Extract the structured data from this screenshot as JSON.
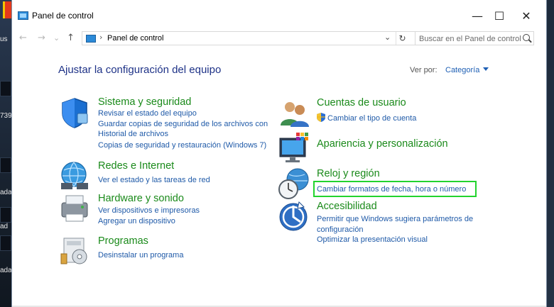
{
  "window": {
    "title": "Panel de control",
    "minimize_glyph": "—",
    "maximize_glyph": "☐",
    "close_glyph": "✕"
  },
  "desktop": {
    "labels": [
      "us",
      "739",
      "ada",
      "ad",
      "ada"
    ]
  },
  "nav": {
    "back_glyph": "←",
    "forward_glyph": "→",
    "dropdown_glyph": "⌄",
    "up_glyph": "↑",
    "breadcrumb_sep": "›",
    "breadcrumb": "Panel de control",
    "addr_dropdown_glyph": "⌄",
    "refresh_glyph": "↻",
    "search_placeholder": "Buscar en el Panel de control"
  },
  "header": {
    "title": "Ajustar la configuración del equipo",
    "view_by_label": "Ver por:",
    "view_by_value": "Categoría"
  },
  "categories": {
    "sistema": {
      "title": "Sistema y seguridad",
      "links": [
        "Revisar el estado del equipo",
        "Guardar copias de seguridad de los archivos con",
        "Historial de archivos",
        "Copias de seguridad y restauración (Windows 7)"
      ]
    },
    "redes": {
      "title": "Redes e Internet",
      "links": [
        "Ver el estado y las tareas de red"
      ]
    },
    "hardware": {
      "title": "Hardware y sonido",
      "links": [
        "Ver dispositivos e impresoras",
        "Agregar un dispositivo"
      ]
    },
    "programas": {
      "title": "Programas",
      "links": [
        "Desinstalar un programa"
      ]
    },
    "cuentas": {
      "title": "Cuentas de usuario",
      "links": [
        "Cambiar el tipo de cuenta"
      ]
    },
    "apariencia": {
      "title": "Apariencia y personalización",
      "links": []
    },
    "reloj": {
      "title": "Reloj y región",
      "links": [
        "Cambiar formatos de fecha, hora o número"
      ]
    },
    "accesibilidad": {
      "title": "Accesibilidad",
      "links": [
        "Permitir que Windows sugiera parámetros de",
        "configuración",
        "Optimizar la presentación visual"
      ]
    }
  },
  "colors": {
    "category_title": "#1a8a1a",
    "link": "#1f5aa8",
    "heading": "#1e3287",
    "highlight": "#22d32e"
  }
}
